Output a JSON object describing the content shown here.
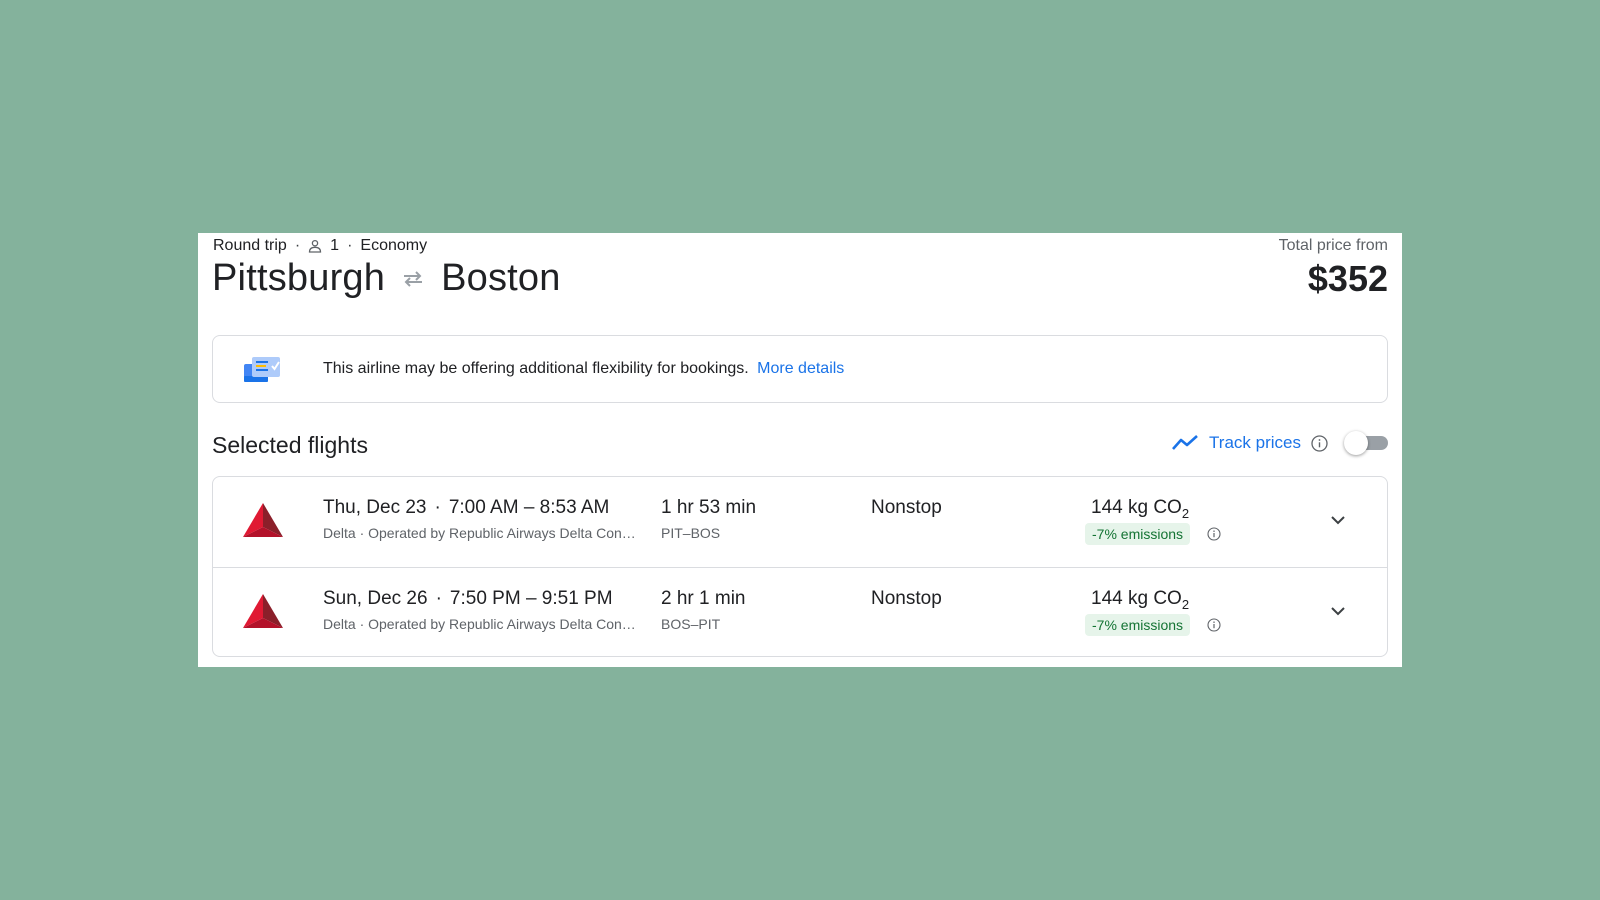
{
  "header": {
    "trip_type": "Round trip",
    "passengers": "1",
    "cabin": "Economy",
    "origin": "Pittsburgh",
    "destination": "Boston",
    "price_label": "Total price from",
    "price": "$352"
  },
  "notice": {
    "text": "This airline may be offering additional flexibility for bookings.",
    "link": "More details"
  },
  "section": {
    "title": "Selected flights",
    "track_label": "Track prices",
    "track_enabled": false
  },
  "flights": [
    {
      "date": "Thu, Dec 23",
      "times": "7:00 AM – 8:53 AM",
      "airline_info": "Delta · Operated by Republic Airways Delta Con…",
      "duration": "1 hr 53 min",
      "airports": "PIT–BOS",
      "stops": "Nonstop",
      "co2_value": "144 kg CO",
      "co2_sub": "2",
      "emissions": "-7% emissions"
    },
    {
      "date": "Sun, Dec 26",
      "times": "7:50 PM – 9:51 PM",
      "airline_info": "Delta · Operated by Republic Airways Delta Con…",
      "duration": "2 hr 1 min",
      "airports": "BOS–PIT",
      "stops": "Nonstop",
      "co2_value": "144 kg CO",
      "co2_sub": "2",
      "emissions": "-7% emissions"
    }
  ],
  "colors": {
    "background": "#84b29c",
    "link": "#1a73e8",
    "badge_bg": "#e6f4ea",
    "badge_text": "#137333",
    "delta_red": "#c8102e"
  },
  "icons": [
    "person-icon",
    "swap-arrows-icon",
    "ticket-flex-icon",
    "trend-icon",
    "info-icon",
    "delta-logo-icon",
    "chevron-down-icon"
  ]
}
